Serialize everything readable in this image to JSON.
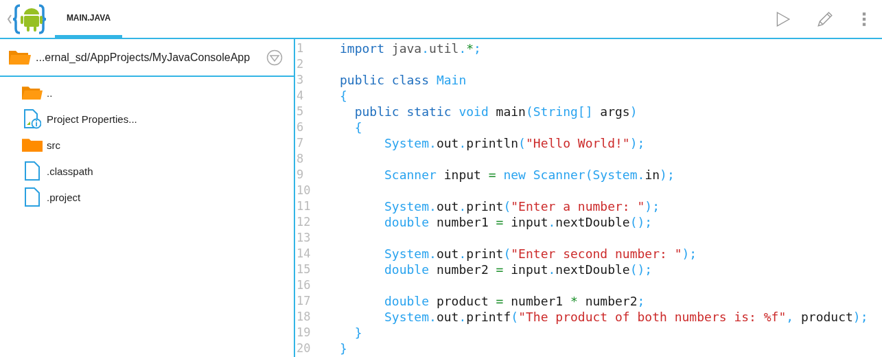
{
  "tabs": [
    {
      "label": "MAIN.JAVA",
      "selected": true
    }
  ],
  "path_bar": {
    "path": "...ernal_sd/AppProjects/MyJavaConsoleApp"
  },
  "files": [
    {
      "name": "..",
      "kind": "folder-open"
    },
    {
      "name": "Project Properties...",
      "kind": "properties"
    },
    {
      "name": "src",
      "kind": "folder"
    },
    {
      "name": ".classpath",
      "kind": "file"
    },
    {
      "name": ".project",
      "kind": "file"
    }
  ],
  "editor": {
    "lines": [
      {
        "number": "1",
        "tokens": [
          {
            "kind": "kw",
            "text": "import "
          },
          {
            "kind": "pkg",
            "text": "java"
          },
          {
            "kind": "punct",
            "text": "."
          },
          {
            "kind": "pkg",
            "text": "util"
          },
          {
            "kind": "punct",
            "text": "."
          },
          {
            "kind": "op",
            "text": "*"
          },
          {
            "kind": "punct",
            "text": ";"
          }
        ]
      },
      {
        "number": "2"
      },
      {
        "number": "3",
        "tokens": [
          {
            "kind": "kw",
            "text": "public class "
          },
          {
            "kind": "type",
            "text": "Main"
          }
        ]
      },
      {
        "number": "4",
        "tokens": [
          {
            "kind": "punct",
            "text": "{"
          }
        ]
      },
      {
        "number": "5",
        "tokens": [
          {
            "kind": "kw",
            "text": "  public static "
          },
          {
            "kind": "type",
            "text": "void "
          },
          {
            "kind": "id",
            "text": "main"
          },
          {
            "kind": "punct",
            "text": "("
          },
          {
            "kind": "type",
            "text": "String[] "
          },
          {
            "kind": "id",
            "text": "args"
          },
          {
            "kind": "punct",
            "text": ")"
          }
        ]
      },
      {
        "number": "6",
        "tokens": [
          {
            "kind": "punct",
            "text": "  {"
          }
        ]
      },
      {
        "number": "7",
        "tokens": [
          {
            "kind": "type",
            "text": "      System"
          },
          {
            "kind": "punct",
            "text": "."
          },
          {
            "kind": "id",
            "text": "out"
          },
          {
            "kind": "punct",
            "text": "."
          },
          {
            "kind": "id",
            "text": "println"
          },
          {
            "kind": "punct",
            "text": "("
          },
          {
            "kind": "str",
            "text": "\"Hello World!\""
          },
          {
            "kind": "punct",
            "text": ");"
          }
        ]
      },
      {
        "number": "8"
      },
      {
        "number": "9",
        "tokens": [
          {
            "kind": "type",
            "text": "      Scanner "
          },
          {
            "kind": "id",
            "text": "input "
          },
          {
            "kind": "op",
            "text": "= "
          },
          {
            "kind": "type",
            "text": "new Scanner"
          },
          {
            "kind": "punct",
            "text": "("
          },
          {
            "kind": "type",
            "text": "System"
          },
          {
            "kind": "punct",
            "text": "."
          },
          {
            "kind": "id",
            "text": "in"
          },
          {
            "kind": "punct",
            "text": ");"
          }
        ]
      },
      {
        "number": "10"
      },
      {
        "number": "11",
        "tokens": [
          {
            "kind": "type",
            "text": "      System"
          },
          {
            "kind": "punct",
            "text": "."
          },
          {
            "kind": "id",
            "text": "out"
          },
          {
            "kind": "punct",
            "text": "."
          },
          {
            "kind": "id",
            "text": "print"
          },
          {
            "kind": "punct",
            "text": "("
          },
          {
            "kind": "str",
            "text": "\"Enter a number: \""
          },
          {
            "kind": "punct",
            "text": ");"
          }
        ]
      },
      {
        "number": "12",
        "tokens": [
          {
            "kind": "type",
            "text": "      double "
          },
          {
            "kind": "id",
            "text": "number1 "
          },
          {
            "kind": "op",
            "text": "= "
          },
          {
            "kind": "id",
            "text": "input"
          },
          {
            "kind": "punct",
            "text": "."
          },
          {
            "kind": "id",
            "text": "nextDouble"
          },
          {
            "kind": "punct",
            "text": "();"
          }
        ]
      },
      {
        "number": "13"
      },
      {
        "number": "14",
        "tokens": [
          {
            "kind": "type",
            "text": "      System"
          },
          {
            "kind": "punct",
            "text": "."
          },
          {
            "kind": "id",
            "text": "out"
          },
          {
            "kind": "punct",
            "text": "."
          },
          {
            "kind": "id",
            "text": "print"
          },
          {
            "kind": "punct",
            "text": "("
          },
          {
            "kind": "str",
            "text": "\"Enter second number: \""
          },
          {
            "kind": "punct",
            "text": ");"
          }
        ]
      },
      {
        "number": "15",
        "tokens": [
          {
            "kind": "type",
            "text": "      double "
          },
          {
            "kind": "id",
            "text": "number2 "
          },
          {
            "kind": "op",
            "text": "= "
          },
          {
            "kind": "id",
            "text": "input"
          },
          {
            "kind": "punct",
            "text": "."
          },
          {
            "kind": "id",
            "text": "nextDouble"
          },
          {
            "kind": "punct",
            "text": "();"
          }
        ]
      },
      {
        "number": "16"
      },
      {
        "number": "17",
        "tokens": [
          {
            "kind": "type",
            "text": "      double "
          },
          {
            "kind": "id",
            "text": "product "
          },
          {
            "kind": "op",
            "text": "= "
          },
          {
            "kind": "id",
            "text": "number1 "
          },
          {
            "kind": "op",
            "text": "* "
          },
          {
            "kind": "id",
            "text": "number2"
          },
          {
            "kind": "punct",
            "text": ";"
          }
        ]
      },
      {
        "number": "18",
        "tokens": [
          {
            "kind": "type",
            "text": "      System"
          },
          {
            "kind": "punct",
            "text": "."
          },
          {
            "kind": "id",
            "text": "out"
          },
          {
            "kind": "punct",
            "text": "."
          },
          {
            "kind": "id",
            "text": "printf"
          },
          {
            "kind": "punct",
            "text": "("
          },
          {
            "kind": "str",
            "text": "\"The product of both numbers is: %f\""
          },
          {
            "kind": "punct",
            "text": ", "
          },
          {
            "kind": "id",
            "text": "product"
          },
          {
            "kind": "punct",
            "text": ");"
          }
        ]
      },
      {
        "number": "19",
        "tokens": [
          {
            "kind": "punct",
            "text": "  }"
          }
        ]
      },
      {
        "number": "20",
        "tokens": [
          {
            "kind": "punct",
            "text": "}"
          }
        ]
      }
    ]
  }
}
